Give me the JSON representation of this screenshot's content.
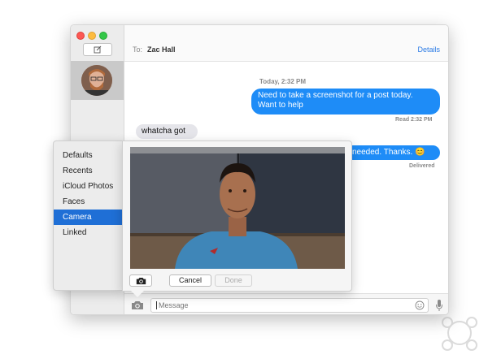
{
  "header": {
    "to_label": "To:",
    "recipient": "Zac Hall",
    "details_label": "Details"
  },
  "messages": {
    "timestamp": "Today, 2:32 PM",
    "outgoing_1_line1": "Need to take a screenshot for a post today.",
    "outgoing_1_line2": "Want to help",
    "read_receipt": "Read 2:32 PM",
    "incoming_1": "whatcha got",
    "outgoing_2": "needed. Thanks. ",
    "outgoing_2_emoji": "😊",
    "delivered": "Delivered"
  },
  "input": {
    "placeholder": "Message"
  },
  "menu": {
    "items": [
      {
        "label": "Defaults",
        "selected": false
      },
      {
        "label": "Recents",
        "selected": false
      },
      {
        "label": "iCloud Photos",
        "selected": false
      },
      {
        "label": "Faces",
        "selected": false
      },
      {
        "label": "Camera",
        "selected": true
      },
      {
        "label": "Linked",
        "selected": false
      }
    ]
  },
  "popover": {
    "cancel_label": "Cancel",
    "done_label": "Done"
  },
  "icons": {
    "compose": "compose-icon",
    "camera": "camera-icon",
    "emoji": "emoji-icon",
    "microphone": "microphone-icon"
  },
  "colors": {
    "accent": "#1e8cf7",
    "selection": "#1f6fd6",
    "link": "#2b7be5"
  }
}
